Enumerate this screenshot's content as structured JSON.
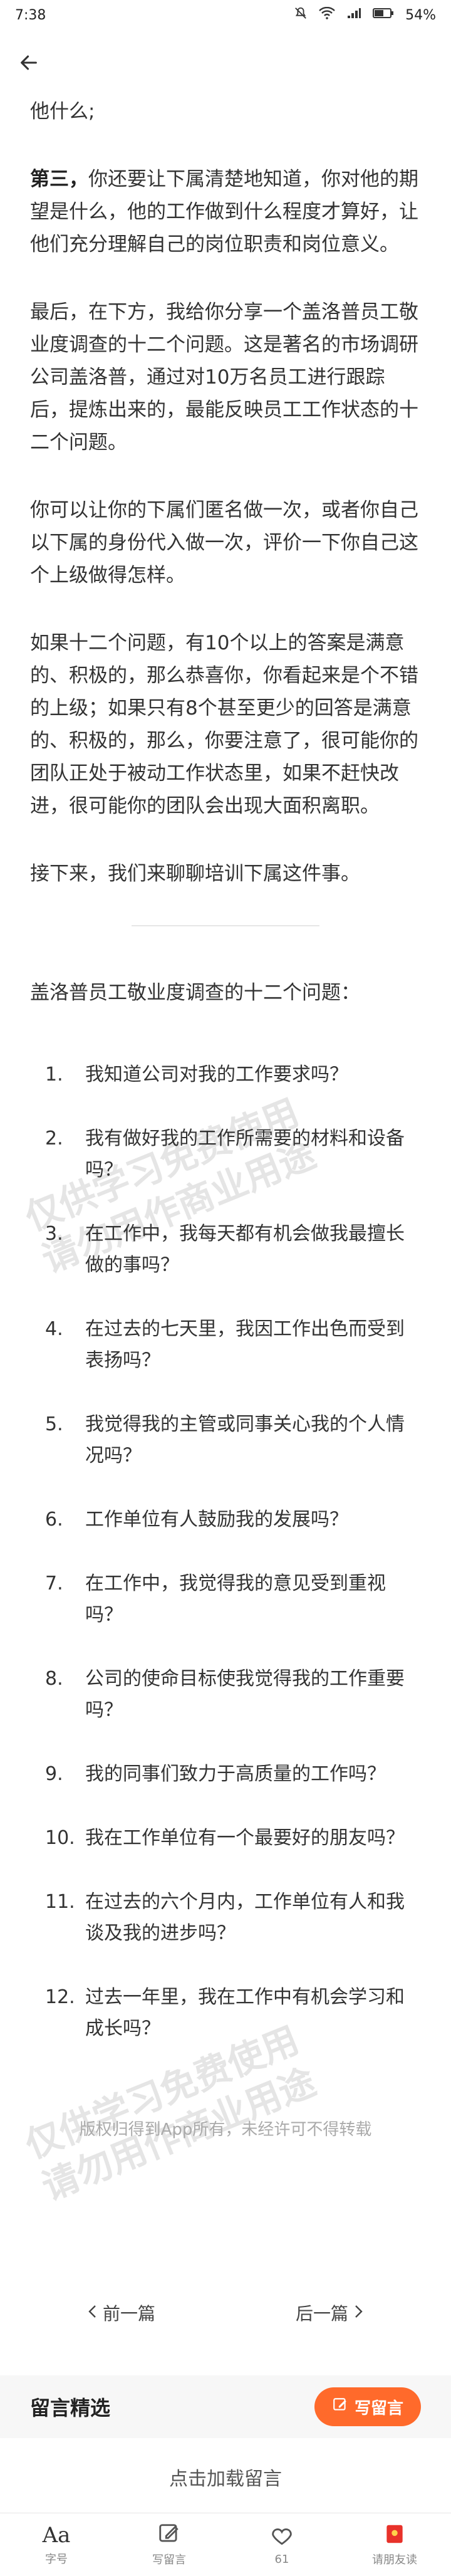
{
  "status_bar": {
    "time": "7:38",
    "battery": "54%"
  },
  "article": {
    "paragraphs": [
      {
        "lead": "",
        "text": "他什么;"
      },
      {
        "lead": "第三，",
        "text": "你还要让下属清楚地知道，你对他的期望是什么，他的工作做到什么程度才算好，让他们充分理解自己的岗位职责和岗位意义。"
      },
      {
        "lead": "",
        "text": "最后，在下方，我给你分享一个盖洛普员工敬业度调查的十二个问题。这是著名的市场调研公司盖洛普，通过对10万名员工进行跟踪后，提炼出来的，最能反映员工工作状态的十二个问题。"
      },
      {
        "lead": "",
        "text": "你可以让你的下属们匿名做一次，或者你自己以下属的身份代入做一次，评价一下你自己这个上级做得怎样。"
      },
      {
        "lead": "",
        "text": "如果十二个问题，有10个以上的答案是满意的、积极的，那么恭喜你，你看起来是个不错的上级；如果只有8个甚至更少的回答是满意的、积极的，那么，你要注意了，很可能你的团队正处于被动工作状态里，如果不赶快改进，很可能你的团队会出现大面积离职。"
      },
      {
        "lead": "",
        "text": "接下来，我们来聊聊培训下属这件事。"
      }
    ],
    "questions_title": "盖洛普员工敬业度调查的十二个问题：",
    "questions": [
      {
        "num": "1.",
        "text": "我知道公司对我的工作要求吗？"
      },
      {
        "num": "2.",
        "text": "我有做好我的工作所需要的材料和设备吗？"
      },
      {
        "num": "3.",
        "text": "在工作中，我每天都有机会做我最擅长做的事吗？"
      },
      {
        "num": "4.",
        "text": "在过去的七天里，我因工作出色而受到表扬吗？"
      },
      {
        "num": "5.",
        "text": "我觉得我的主管或同事关心我的个人情况吗？"
      },
      {
        "num": "6.",
        "text": "工作单位有人鼓励我的发展吗？"
      },
      {
        "num": "7.",
        "text": "在工作中，我觉得我的意见受到重视吗？"
      },
      {
        "num": "8.",
        "text": "公司的使命目标使我觉得我的工作重要吗？"
      },
      {
        "num": "9.",
        "text": "我的同事们致力于高质量的工作吗？"
      },
      {
        "num": "10.",
        "text": "我在工作单位有一个最要好的朋友吗？"
      },
      {
        "num": "11.",
        "text": "在过去的六个月内，工作单位有人和我谈及我的进步吗？"
      },
      {
        "num": "12.",
        "text": "过去一年里，我在工作中有机会学习和成长吗？"
      }
    ],
    "copyright": "版权归得到App所有，未经许可不得转载"
  },
  "watermarks": {
    "line1": "仅供学习免费使用",
    "line2": "请勿用作商业用途"
  },
  "nav": {
    "prev": "前一篇",
    "next": "后一篇"
  },
  "comments": {
    "title": "留言精选",
    "write_button": "写留言",
    "load_text": "点击加载留言"
  },
  "bottom_bar": {
    "font_label": "字号",
    "font_icon_text": "Aa",
    "write_label": "写留言",
    "like_count": "61",
    "invite_label": "请朋友读"
  },
  "colors": {
    "accent": "#ff6a2b",
    "invite_red": "#e8322a"
  }
}
